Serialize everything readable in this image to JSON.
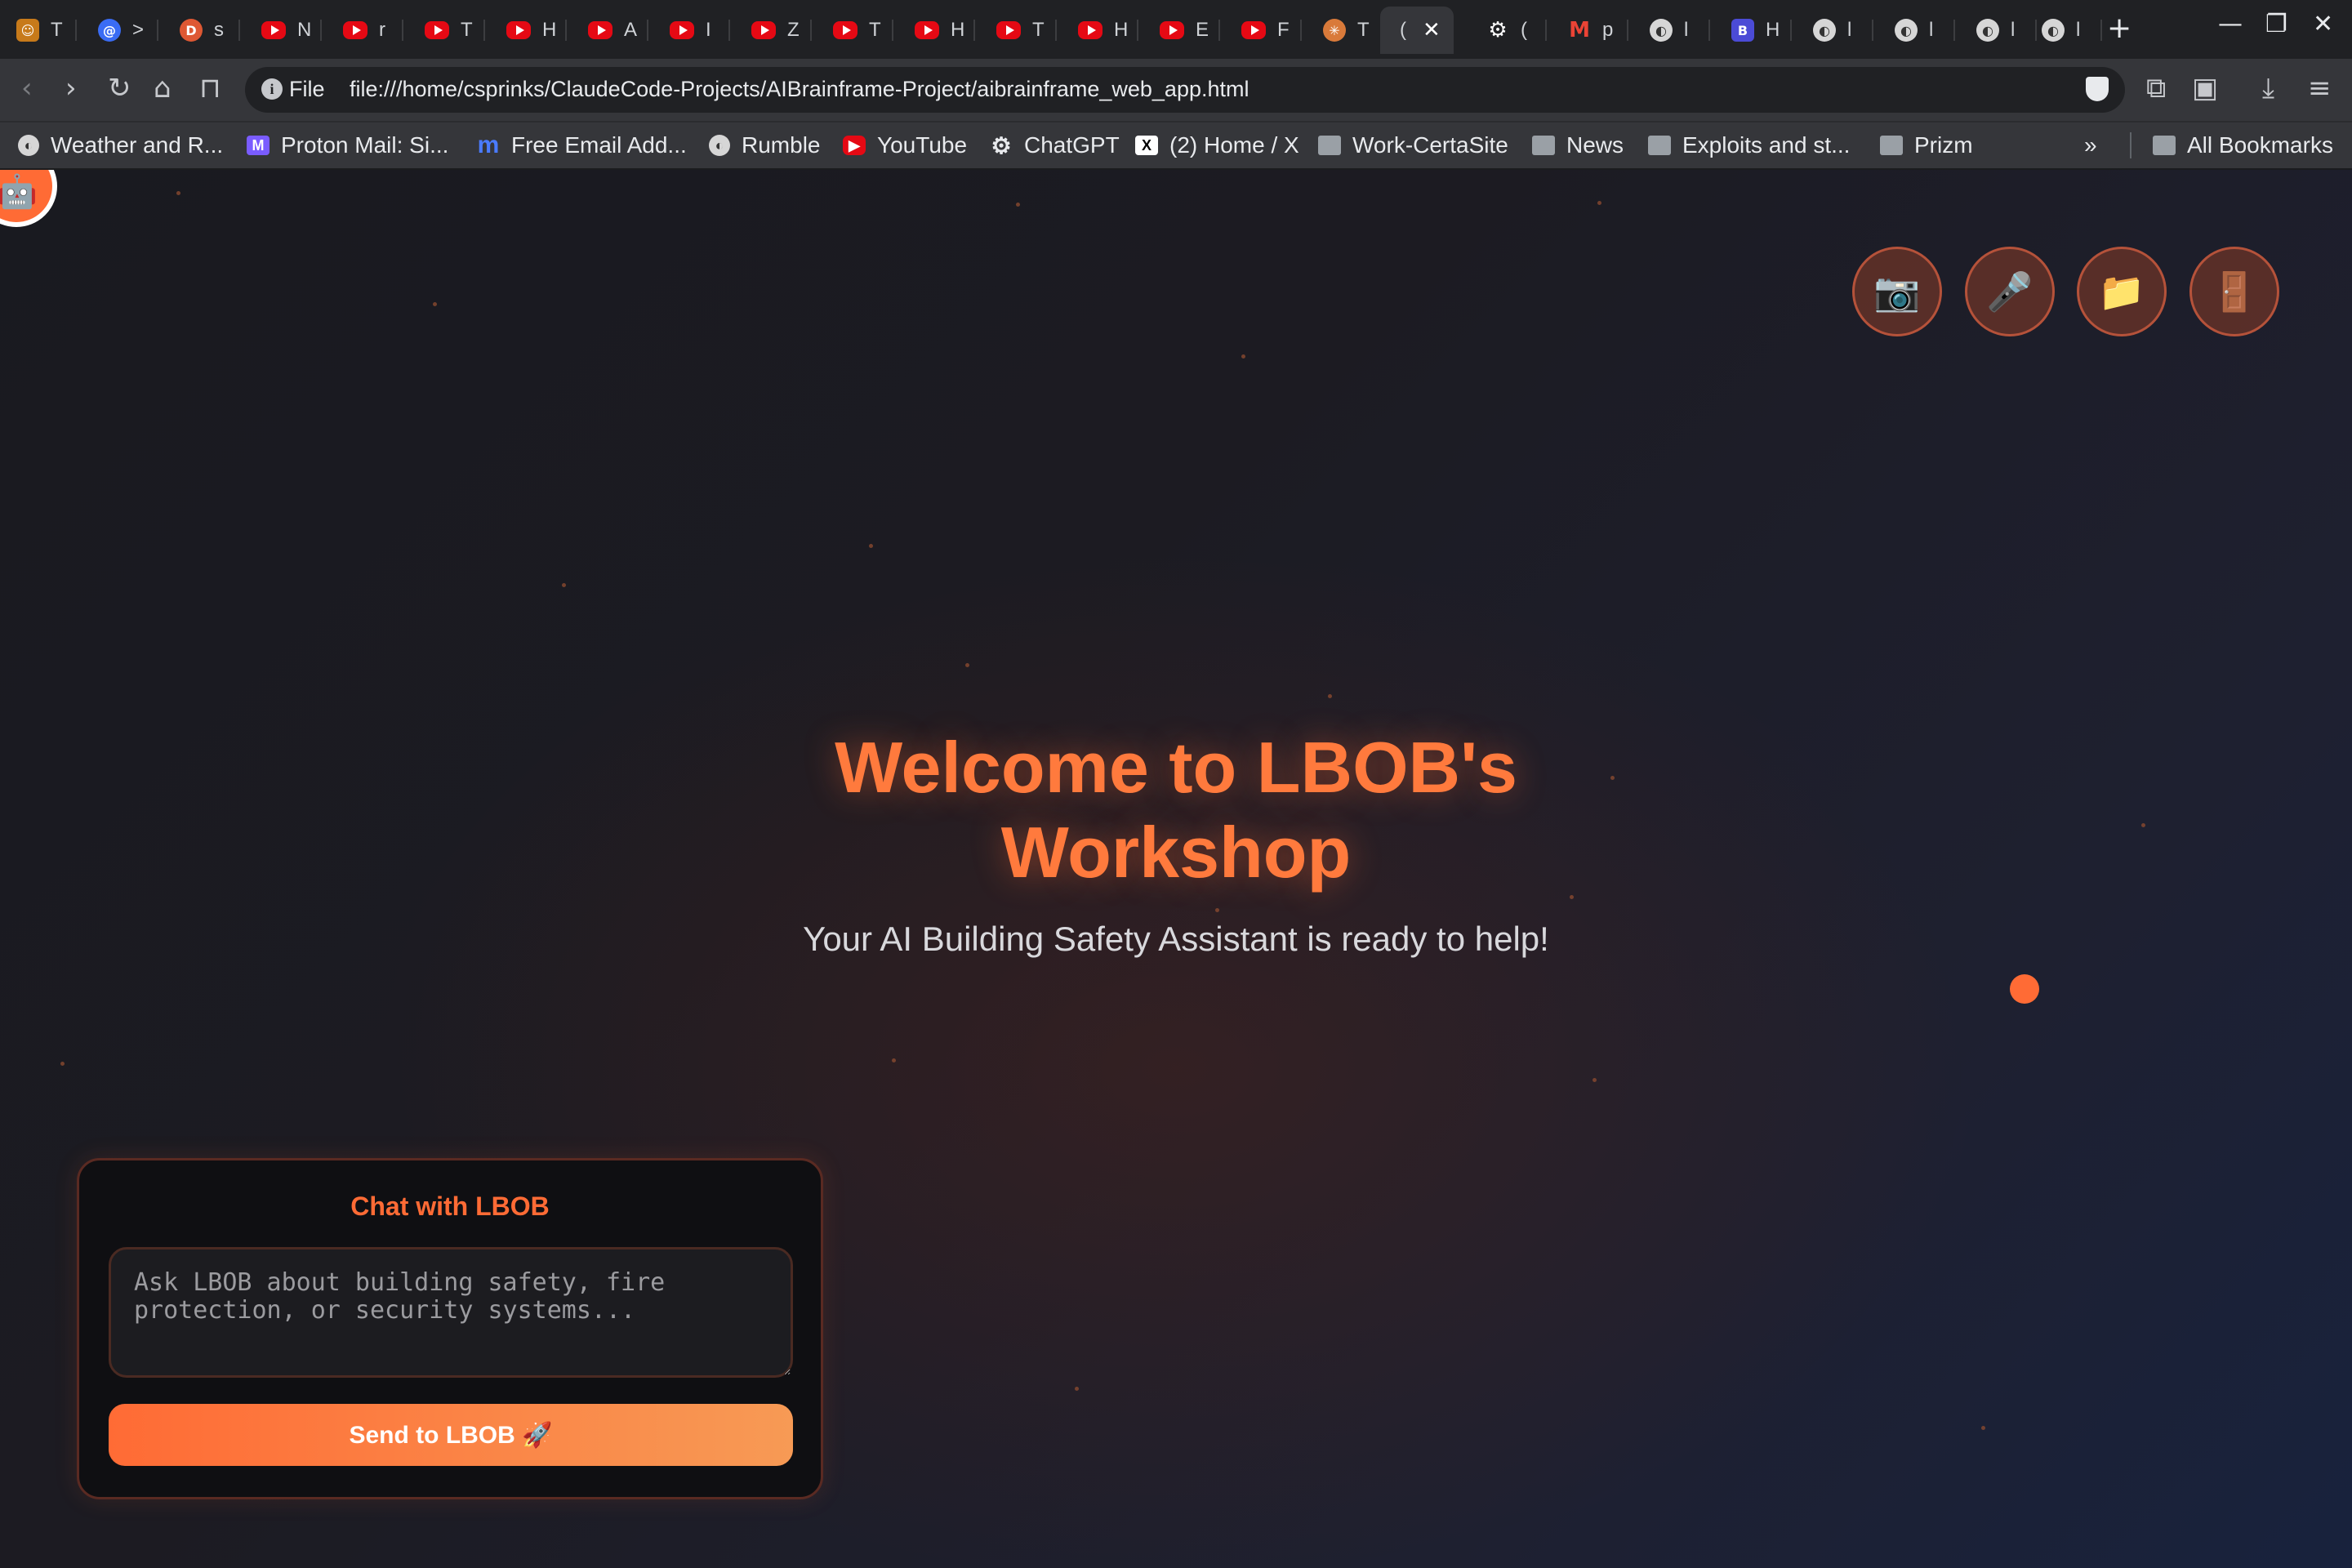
{
  "browser": {
    "tabs": [
      {
        "title": "T",
        "icon": "person-emoji-icon"
      },
      {
        "title": ">",
        "icon": "at-sign-icon"
      },
      {
        "title": "s",
        "icon": "duckduckgo-icon"
      },
      {
        "title": "N",
        "icon": "youtube-icon"
      },
      {
        "title": "r",
        "icon": "youtube-icon"
      },
      {
        "title": "T",
        "icon": "youtube-icon"
      },
      {
        "title": "H",
        "icon": "youtube-icon"
      },
      {
        "title": "A",
        "icon": "youtube-icon"
      },
      {
        "title": "I",
        "icon": "youtube-icon"
      },
      {
        "title": "Z",
        "icon": "youtube-icon"
      },
      {
        "title": "T",
        "icon": "youtube-icon"
      },
      {
        "title": "H",
        "icon": "youtube-icon"
      },
      {
        "title": "T",
        "icon": "youtube-icon"
      },
      {
        "title": "H",
        "icon": "youtube-icon"
      },
      {
        "title": "E",
        "icon": "youtube-icon"
      },
      {
        "title": "F",
        "icon": "youtube-icon"
      },
      {
        "title": "T",
        "icon": "claude-icon"
      },
      {
        "title": "(",
        "icon": "none",
        "active": true
      },
      {
        "title": "(",
        "icon": "chatgpt-icon"
      },
      {
        "title": "p",
        "icon": "gmail-icon"
      },
      {
        "title": "l",
        "icon": "globe-icon"
      },
      {
        "title": "H",
        "icon": "app-icon"
      },
      {
        "title": "l",
        "icon": "globe-icon"
      },
      {
        "title": "l",
        "icon": "globe-icon"
      },
      {
        "title": "l",
        "icon": "globe-icon"
      },
      {
        "title": "l",
        "icon": "globe-icon"
      }
    ],
    "new_tab": "+",
    "omnibox": {
      "scheme": "File",
      "url": "file:///home/csprinks/ClaudeCode-Projects/AIBrainframe-Project/aibrainframe_web_app.html"
    },
    "bookmarks": [
      {
        "label": "Weather and R...",
        "icon": "globe-icon"
      },
      {
        "label": "Proton Mail: Si...",
        "icon": "proton-icon"
      },
      {
        "label": "Free Email Add...",
        "icon": "m-icon"
      },
      {
        "label": "Rumble",
        "icon": "globe-icon"
      },
      {
        "label": "YouTube",
        "icon": "youtube-icon"
      },
      {
        "label": "ChatGPT",
        "icon": "chatgpt-icon"
      },
      {
        "label": "(2) Home / X",
        "icon": "x-icon"
      },
      {
        "label": "Work-CertaSite",
        "icon": "folder-icon"
      },
      {
        "label": "News",
        "icon": "folder-icon"
      },
      {
        "label": "Exploits and st...",
        "icon": "folder-icon"
      },
      {
        "label": "Prizm",
        "icon": "folder-icon"
      }
    ],
    "bookmarks_overflow": "»",
    "all_bookmarks": "All Bookmarks"
  },
  "page": {
    "hero": {
      "title": "Welcome to LBOB's Workshop",
      "subtitle": "Your AI Building Safety Assistant is ready to help!"
    },
    "actions": [
      {
        "icon": "camera-icon",
        "glyph": "📷"
      },
      {
        "icon": "microphone-icon",
        "glyph": "🎤"
      },
      {
        "icon": "folder-icon",
        "glyph": "📁"
      },
      {
        "icon": "door-icon",
        "glyph": "🚪"
      }
    ],
    "chat": {
      "title": "Chat with LBOB",
      "placeholder": "Ask LBOB about building safety, fire protection, or security systems...",
      "value": "",
      "send_label": "Send to LBOB 🚀"
    },
    "colors": {
      "accent": "#ff6b35",
      "title": "#ff7a3d"
    }
  }
}
